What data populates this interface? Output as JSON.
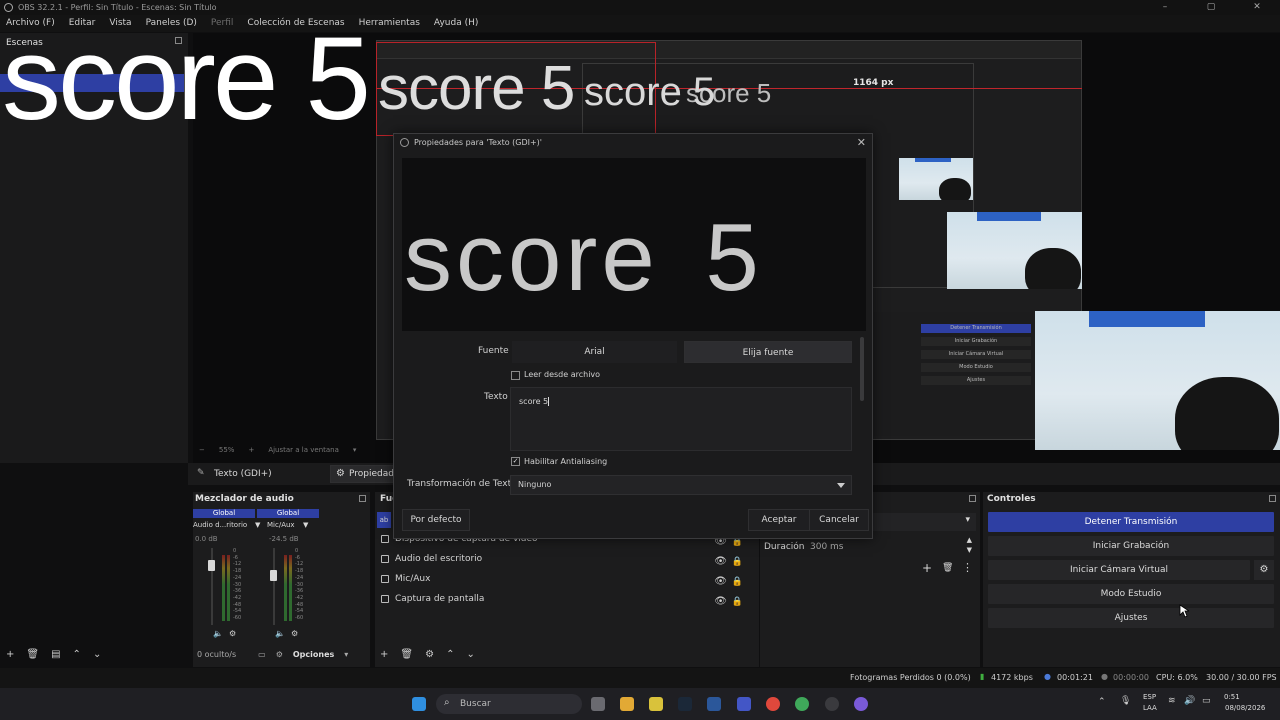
{
  "window": {
    "title": "OBS 32.2.1 - Perfil: Sin Título - Escenas: Sin Título",
    "controls": [
      "–",
      "▢",
      "✕"
    ]
  },
  "menu": [
    {
      "label": "Archivo (F)",
      "dim": false
    },
    {
      "label": "Editar",
      "dim": false
    },
    {
      "label": "Vista",
      "dim": false
    },
    {
      "label": "Paneles (D)",
      "dim": false
    },
    {
      "label": "Perfil",
      "dim": true
    },
    {
      "label": "Colección de Escenas",
      "dim": false
    },
    {
      "label": "Herramientas",
      "dim": false
    },
    {
      "label": "Ayuda (H)",
      "dim": false
    }
  ],
  "scenes": {
    "title": "Escenas"
  },
  "preview": {
    "overlay_text": "score 5",
    "px_label": "1164 px",
    "zoom": "55%",
    "fit_label": "Ajustar a la ventana",
    "nested_controls": [
      "Detener Transmisión",
      "Iniciar Grabación",
      "Iniciar Cámara Virtual",
      "Modo Estudio",
      "Ajustes"
    ]
  },
  "dialog": {
    "title": "Propiedades para 'Texto (GDI+)'",
    "preview_text": "score 5",
    "font_label": "Fuente",
    "font_value": "Arial",
    "choose_font": "Elija fuente",
    "read_from_file": "Leer desde archivo",
    "read_from_file_checked": false,
    "text_label": "Texto",
    "text_value": "score 5",
    "antialias_label": "Habilitar Antialiasing",
    "antialias_checked": true,
    "transform_label": "Transformación de Texto",
    "transform_value": "Ninguno",
    "defaults_button": "Por defecto",
    "accept_button": "Aceptar",
    "cancel_button": "Cancelar"
  },
  "source_toolbar": {
    "selected_source": "Texto (GDI+)",
    "properties": "Propiedades"
  },
  "mixer": {
    "title": "Mezclador de audio",
    "channels": [
      {
        "tag": "Global",
        "name": "Audio d...ritorio",
        "db": "0.0 dB",
        "level": 0.4
      },
      {
        "tag": "Global",
        "name": "Mic/Aux",
        "db": "-24.5 dB",
        "level": 0.25
      }
    ],
    "scale": [
      "0",
      "-6",
      "-12",
      "-18",
      "-24",
      "-30",
      "-36",
      "-42",
      "-48",
      "-54",
      "-60"
    ],
    "hidden": "0 oculto/s",
    "options": "Opciones"
  },
  "sources": {
    "title": "Fuentes",
    "items": [
      {
        "name": "Dispositivo de captura de vídeo"
      },
      {
        "name": "Audio del escritorio"
      },
      {
        "name": "Mic/Aux"
      },
      {
        "name": "Captura de pantalla"
      }
    ]
  },
  "transitions": {
    "duration_label": "Duración",
    "duration_value": "300 ms"
  },
  "controls": {
    "title": "Controles",
    "buttons": [
      "Detener Transmisión",
      "Iniciar Grabación",
      "Iniciar Cámara Virtual",
      "Modo Estudio",
      "Ajustes"
    ]
  },
  "status": {
    "dropped": "Fotogramas Perdidos 0 (0.0%)",
    "bitrate": "4172 kbps",
    "stream_time": "00:01:21",
    "rec_time": "00:00:00",
    "cpu": "CPU: 6.0%",
    "fps": "30.00 / 30.00 FPS"
  },
  "taskbar": {
    "search": "Buscar",
    "lang": "ESP",
    "lang2": "LAA",
    "time": "0:51",
    "date": "08/08/2026"
  },
  "colors": {
    "accent": "#2e3fa3",
    "recording_red": "#c0262c",
    "background": "#1c1c1d"
  }
}
